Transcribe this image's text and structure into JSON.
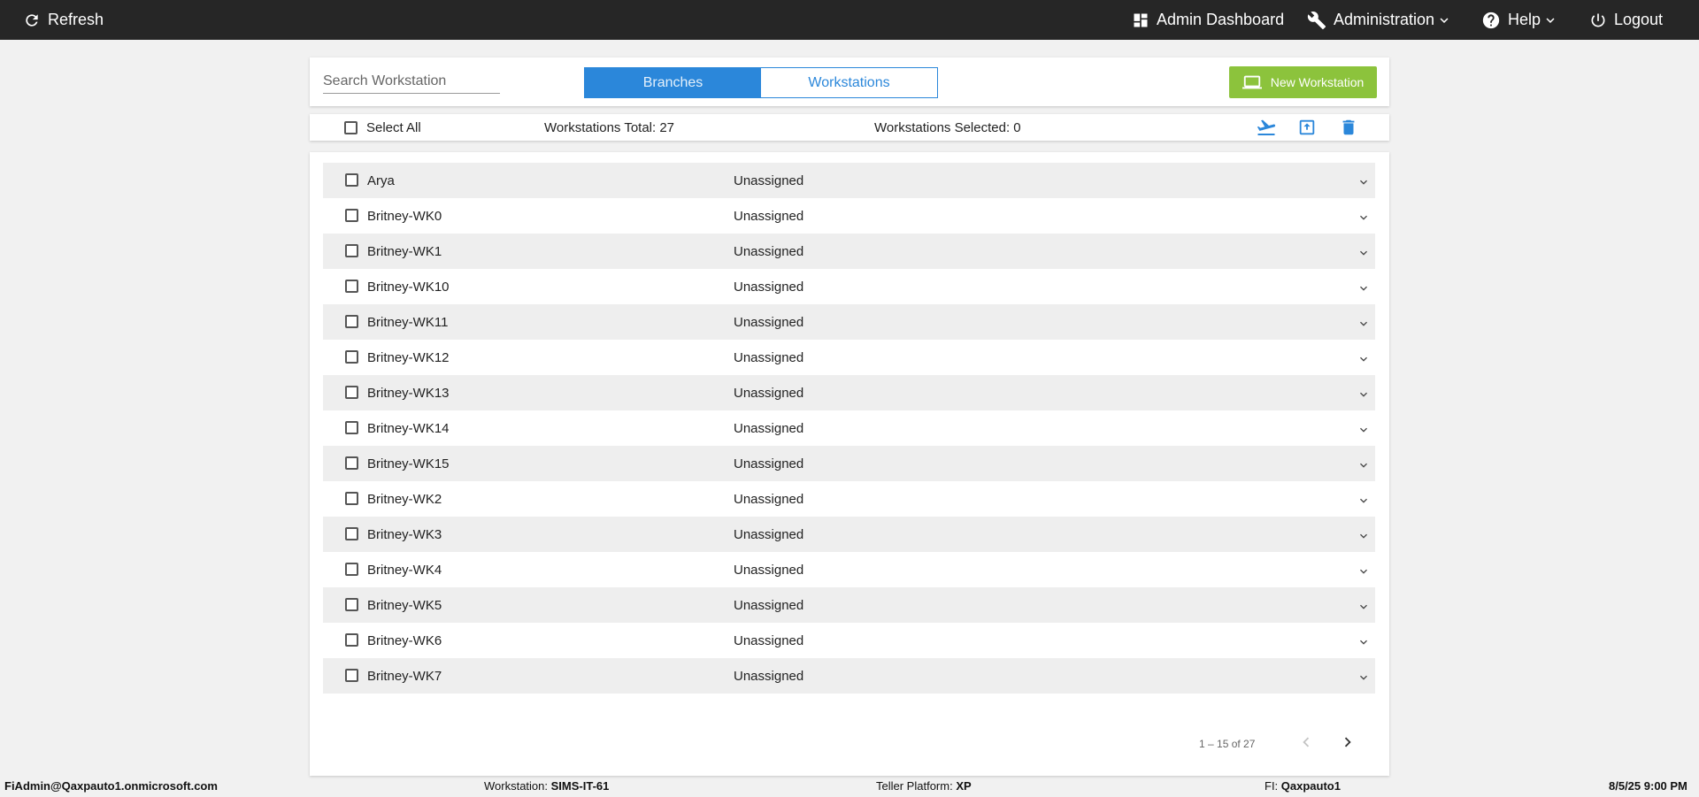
{
  "topbar": {
    "refresh": "Refresh",
    "admin_dashboard": "Admin Dashboard",
    "administration": "Administration",
    "help": "Help",
    "logout": "Logout"
  },
  "header": {
    "search_placeholder": "Search Workstation",
    "toggle": [
      "Branches",
      "Workstations"
    ],
    "toggle_active": "Branches",
    "new_button": "New Workstation"
  },
  "toolbar": {
    "select_all": "Select All",
    "total": "Workstations Total: 27",
    "selected": "Workstations Selected: 0"
  },
  "workstations": [
    {
      "name": "Arya",
      "status": "Unassigned"
    },
    {
      "name": "Britney-WK0",
      "status": "Unassigned"
    },
    {
      "name": "Britney-WK1",
      "status": "Unassigned"
    },
    {
      "name": "Britney-WK10",
      "status": "Unassigned"
    },
    {
      "name": "Britney-WK11",
      "status": "Unassigned"
    },
    {
      "name": "Britney-WK12",
      "status": "Unassigned"
    },
    {
      "name": "Britney-WK13",
      "status": "Unassigned"
    },
    {
      "name": "Britney-WK14",
      "status": "Unassigned"
    },
    {
      "name": "Britney-WK15",
      "status": "Unassigned"
    },
    {
      "name": "Britney-WK2",
      "status": "Unassigned"
    },
    {
      "name": "Britney-WK3",
      "status": "Unassigned"
    },
    {
      "name": "Britney-WK4",
      "status": "Unassigned"
    },
    {
      "name": "Britney-WK5",
      "status": "Unassigned"
    },
    {
      "name": "Britney-WK6",
      "status": "Unassigned"
    },
    {
      "name": "Britney-WK7",
      "status": "Unassigned"
    }
  ],
  "pagination": {
    "range": "1 – 15 of 27"
  },
  "footer": {
    "user": "FiAdmin@Qaxpauto1.onmicrosoft.com",
    "workstation_label": "Workstation:",
    "workstation_value": "SIMS-IT-61",
    "platform_label": "Teller Platform:",
    "platform_value": "XP",
    "fi_label": "FI:",
    "fi_value": "Qaxpauto1",
    "datetime": "8/5/25 9:00 PM"
  },
  "colors": {
    "topbar": "#262626",
    "accent_blue": "#2b87da",
    "new_button_green": "#8cc33c",
    "row_alt": "#eeeeee"
  }
}
